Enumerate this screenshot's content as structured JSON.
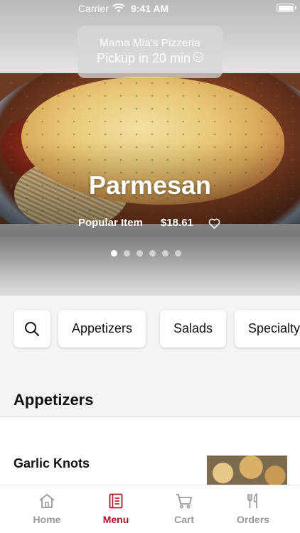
{
  "status_bar": {
    "carrier": "Carrier",
    "time": "9:41 AM"
  },
  "pickup": {
    "restaurant": "Mama Mia's Pizzeria",
    "time_text": "Pickup in 20 min"
  },
  "featured": {
    "title": "Parmesan",
    "tag": "Popular Item",
    "price": "$18.61",
    "dots_total": 6,
    "dots_active": 1
  },
  "categories": [
    "Appetizers",
    "Salads",
    "Specialty"
  ],
  "section": {
    "title": "Appetizers"
  },
  "items": [
    {
      "name": "Garlic Knots"
    }
  ],
  "tabs": {
    "home": "Home",
    "menu": "Menu",
    "cart": "Cart",
    "orders": "Orders"
  },
  "colors": {
    "accent": "#a8182a",
    "inactive": "#999999"
  }
}
